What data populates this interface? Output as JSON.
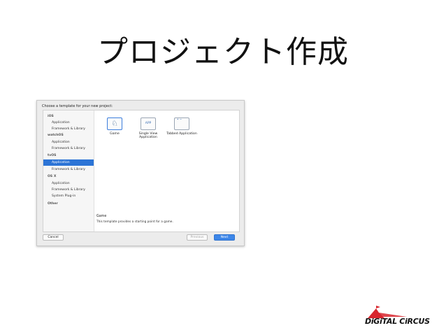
{
  "slide": {
    "title": "プロジェクト作成"
  },
  "dialog": {
    "header": "Choose a template for your new project:",
    "sidebar": [
      {
        "label": "iOS",
        "kind": "group"
      },
      {
        "label": "Application",
        "kind": "item"
      },
      {
        "label": "Framework & Library",
        "kind": "item"
      },
      {
        "label": "watchOS",
        "kind": "group"
      },
      {
        "label": "Application",
        "kind": "item"
      },
      {
        "label": "Framework & Library",
        "kind": "item"
      },
      {
        "label": "tvOS",
        "kind": "group"
      },
      {
        "label": "Application",
        "kind": "item",
        "selected": true
      },
      {
        "label": "Framework & Library",
        "kind": "item"
      },
      {
        "label": "OS X",
        "kind": "group"
      },
      {
        "label": "Application",
        "kind": "item"
      },
      {
        "label": "Framework & Library",
        "kind": "item"
      },
      {
        "label": "System Plug-in",
        "kind": "item"
      },
      {
        "label": "Other",
        "kind": "group"
      }
    ],
    "templates": [
      {
        "label": "Game",
        "icon": "game-icon",
        "glyph": "♘",
        "selected": true
      },
      {
        "label": "Single View Application",
        "icon": "app-icon",
        "glyph": "APP"
      },
      {
        "label": "Tabbed Application",
        "icon": "tabbed-app-icon",
        "glyph": "• ─"
      }
    ],
    "description": {
      "title": "Game",
      "text": "This template provides a starting point for a game."
    },
    "buttons": {
      "cancel": "Cancel",
      "previous": "Previous",
      "next": "Next"
    }
  },
  "logo": {
    "text": "DiGiTAL CiRCUS",
    "accent": "#d8262e"
  },
  "colors": {
    "selection": "#2c74d6",
    "next_button": "#3d86e8"
  }
}
